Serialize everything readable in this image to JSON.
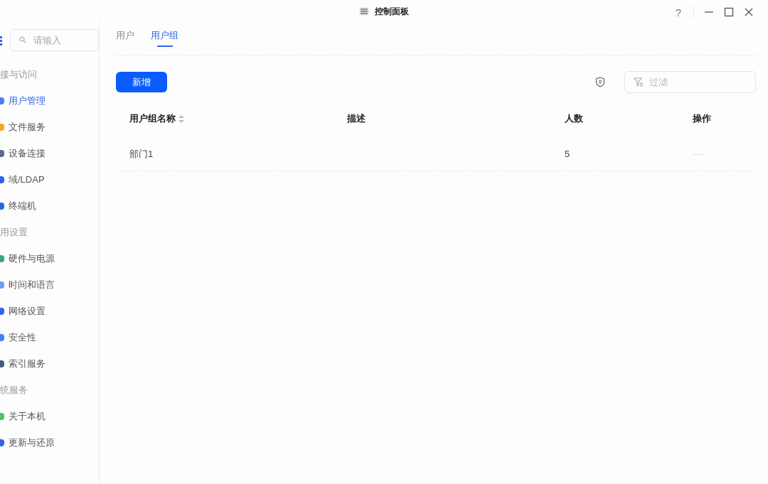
{
  "window": {
    "title": "控制面板",
    "help": "?"
  },
  "sidebar": {
    "search": {
      "placeholder": "请输入"
    },
    "sections": [
      {
        "title": "接与访问",
        "items": [
          {
            "label": "用户管理",
            "selected": true,
            "color": "#4a7cf6"
          },
          {
            "label": "文件服务",
            "selected": false,
            "color": "#f5a623"
          },
          {
            "label": "设备连接",
            "selected": false,
            "color": "#5a6a8a"
          },
          {
            "label": "域/LDAP",
            "selected": false,
            "color": "#2f63e8"
          },
          {
            "label": "终端机",
            "selected": false,
            "color": "#2f63e8"
          }
        ]
      },
      {
        "title": "用设置",
        "items": [
          {
            "label": "硬件与电源",
            "selected": false,
            "color": "#3aa776"
          },
          {
            "label": "时间和语言",
            "selected": false,
            "color": "#6f9cf7"
          },
          {
            "label": "网络设置",
            "selected": false,
            "color": "#2f63e8"
          },
          {
            "label": "安全性",
            "selected": false,
            "color": "#4a7cf6"
          },
          {
            "label": "索引服务",
            "selected": false,
            "color": "#4a5a7a"
          }
        ]
      },
      {
        "title": "统服务",
        "items": [
          {
            "label": "关于本机",
            "selected": false,
            "color": "#4cc46a"
          },
          {
            "label": "更新与还原",
            "selected": false,
            "color": "#2f63e8"
          }
        ]
      }
    ]
  },
  "tabs": [
    {
      "label": "用户",
      "selected": false
    },
    {
      "label": "用户组",
      "selected": true
    }
  ],
  "toolbar": {
    "add_button": "新增",
    "filter": {
      "placeholder": "过滤"
    }
  },
  "table": {
    "columns": [
      {
        "label": "用户组名称",
        "sortable": true
      },
      {
        "label": "描述",
        "sortable": false
      },
      {
        "label": "人数",
        "sortable": false
      },
      {
        "label": "操作",
        "sortable": false
      }
    ],
    "rows": [
      {
        "name": "部门1",
        "count": "5",
        "actions": "···"
      }
    ]
  }
}
